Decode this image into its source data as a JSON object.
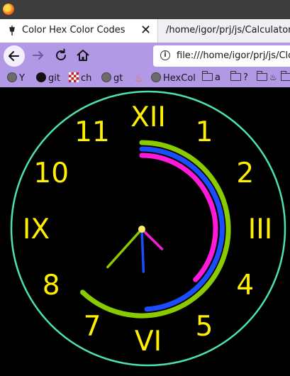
{
  "browser": {
    "tabs": [
      {
        "label": "Color Hex Color Codes",
        "active": true
      },
      {
        "label": "/home/igor/prj/js/Calculator/ind",
        "active": false
      }
    ],
    "url": "file:///home/igor/prj/js/Clock/",
    "bookmarks": [
      {
        "label": "Y",
        "icon": "globe-icon"
      },
      {
        "label": "git",
        "icon": "github-icon"
      },
      {
        "label": "ch",
        "icon": "chess-icon"
      },
      {
        "label": "gt",
        "icon": "globe-icon"
      },
      {
        "label": "",
        "icon": "java-icon"
      },
      {
        "label": "HexCol",
        "icon": "globe-icon"
      },
      {
        "label": "a",
        "icon": "folder-icon"
      },
      {
        "label": "?",
        "icon": "folder-icon"
      },
      {
        "label": "",
        "icon": "folder-icon"
      }
    ]
  },
  "clock": {
    "numerals": [
      "XII",
      "1",
      "2",
      "III",
      "4",
      "5",
      "VI",
      "7",
      "8",
      "IX",
      "10",
      "11"
    ],
    "time": {
      "hours": 4,
      "minutes": 29,
      "seconds": 37
    },
    "colors": {
      "background": "#000000",
      "face_ring": "#4de3b0",
      "numerals": "#ffef00",
      "hour_hand": "#ff1ad9",
      "minute_hand": "#1a4dff",
      "second_hand": "#8acb00",
      "center": "#ffef60"
    },
    "arcs": [
      {
        "name": "seconds-arc",
        "color": "#8acb00",
        "fraction_of_circle": 0.62
      },
      {
        "name": "minutes-arc",
        "color": "#1a4dff",
        "fraction_of_circle": 0.49
      },
      {
        "name": "hours-arc",
        "color": "#ff1ad9",
        "fraction_of_circle": 0.37
      }
    ]
  }
}
